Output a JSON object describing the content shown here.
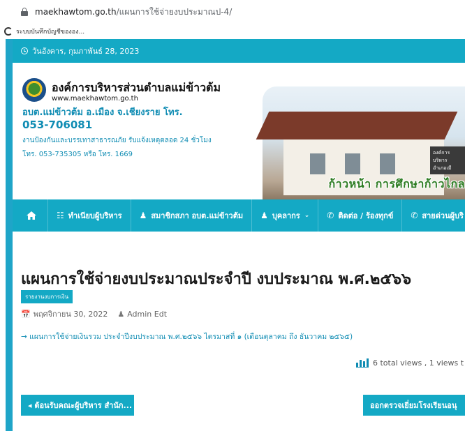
{
  "browser": {
    "url_host": "maekhawtom.go.th",
    "url_path": "/แผนการใช้จ่ายงบประมาณป-4/",
    "bookmark_label": "ระบบบันทึกบัญชีขององ..."
  },
  "topbar": {
    "date": "วันอังคาร, กุมภาพันธ์ 28, 2023"
  },
  "header": {
    "org_name": "องค์การบริหารส่วนตำบลแม่ข้าวต้ม",
    "org_url": "www.maekhawtom.go.th",
    "org_sub": "อบต.แม่ข้าวต้ม อ.เมือง จ.เชียงราย โทร.",
    "phone": "053-706081",
    "note1": "งานป้องกันและบรรเทาสาธารณภัย รับแจ้งเหตุตลอด 24 ชั่วโมง",
    "note2": "โทร. 053-735305 หรือ โทร. 1669",
    "slogan": "ก้าวหน้า การศึกษาก้าวไกล",
    "sign_text": "องค์การบริหาร อำเภอเมื"
  },
  "nav": {
    "items": [
      {
        "label": "ทำเนียบผู้บริหาร",
        "icon": "sitemap-icon"
      },
      {
        "label": "สมาชิกสภา อบต.แม่ข้าวต้ม",
        "icon": "user-icon"
      },
      {
        "label": "บุคลากร",
        "icon": "user-icon"
      },
      {
        "label": "ติดต่อ / ร้องทุกข์",
        "icon": "phone-icon"
      },
      {
        "label": "สายด่วนผู้บริ",
        "icon": "phone-icon"
      }
    ]
  },
  "post": {
    "title": "แผนการใช้จ่ายงบประมาณประจำปี งบประมาณ พ.ศ.๒๕๖๖",
    "category": "รายงานงบการเงิน",
    "date": "พฤศจิกายน 30, 2022",
    "author": "Admin Edt",
    "link": "→ แผนการใช้จ่ายเงินรวม ประจำปีงบประมาณ พ.ศ.๒๕๖๖ ไตรมาสที่ ๑ (เดือนตุลาคม ถึง ธันวาคม ๒๕๖๕)",
    "views": "6 total views , 1 views t"
  },
  "pager": {
    "prev": "◂ ต้อนรับคณะผู้บริหาร สำนัก...",
    "next": "ออกตรวจเยี่ยมโรงเรียนอนุ"
  }
}
